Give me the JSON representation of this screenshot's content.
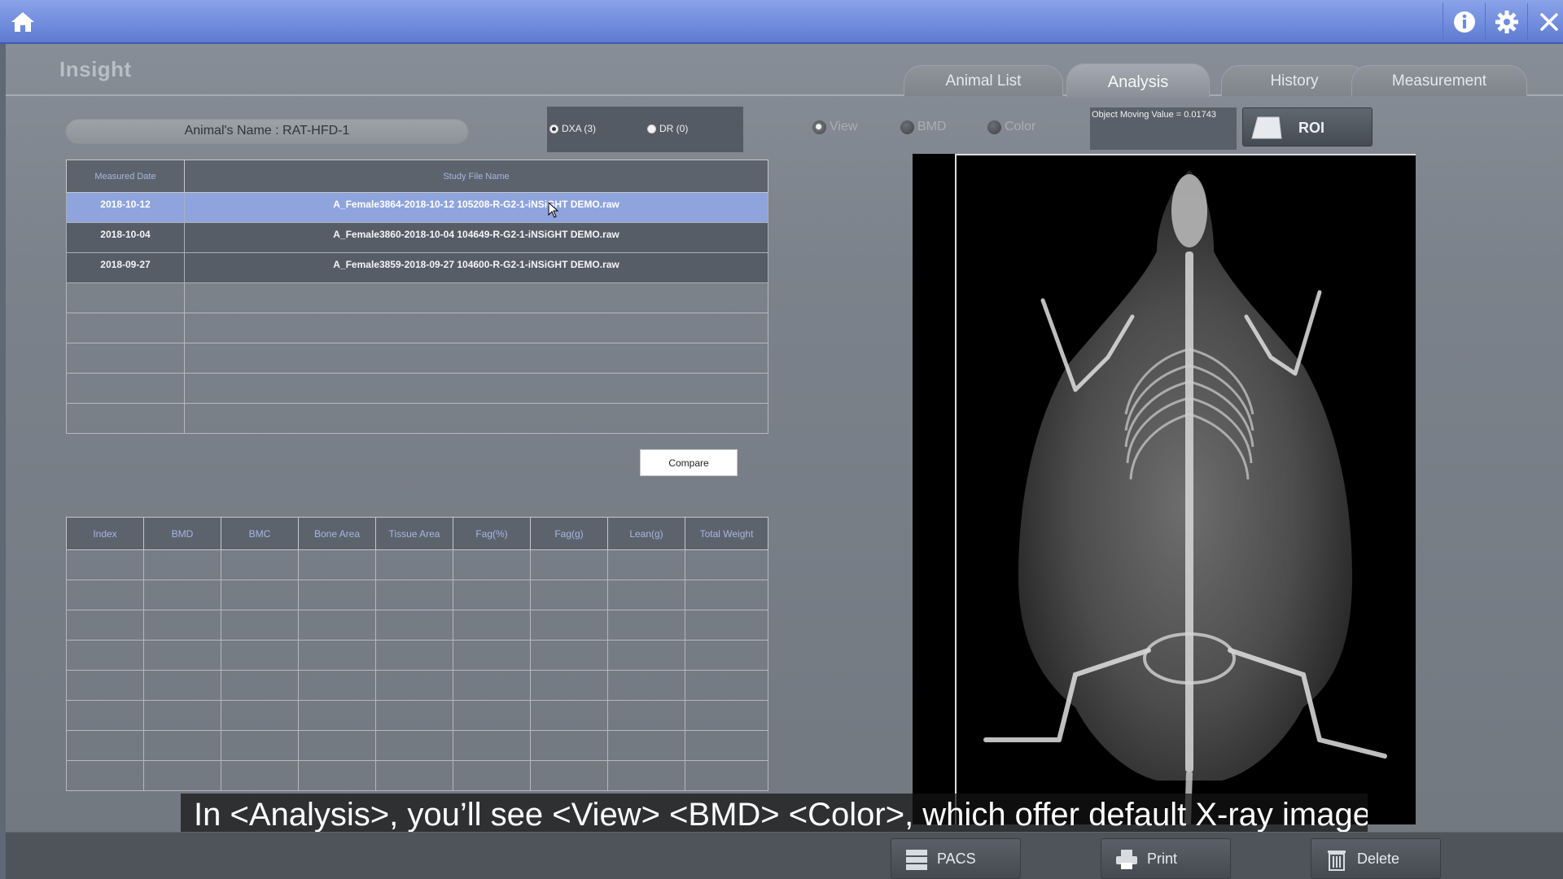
{
  "app": {
    "brand": "Insight"
  },
  "tabs": [
    {
      "label": "Animal List",
      "active": false
    },
    {
      "label": "Analysis",
      "active": true
    },
    {
      "label": "History",
      "active": false
    },
    {
      "label": "Measurement",
      "active": false
    }
  ],
  "animal": {
    "name_label": "Animal's Name  : RAT-HFD-1"
  },
  "modes": {
    "dxa": "DXA (3)",
    "dr": "DR (0)",
    "selected": "dxa"
  },
  "view_options": {
    "view": "View",
    "bmd": "BMD",
    "color": "Color",
    "selected": "view"
  },
  "object_moving": "Object Moving Value = 0.01743",
  "roi_label": "ROI",
  "study_table": {
    "headers": [
      "Measured Date",
      "Study File Name"
    ],
    "rows": [
      {
        "date": "2018-10-12",
        "file": "A_Female3864-2018-10-12 105208-R-G2-1-iNSiGHT DEMO.raw"
      },
      {
        "date": "2018-10-04",
        "file": "A_Female3860-2018-10-04 104649-R-G2-1-iNSiGHT DEMO.raw"
      },
      {
        "date": "2018-09-27",
        "file": "A_Female3859-2018-09-27 104600-R-G2-1-iNSiGHT DEMO.raw"
      }
    ],
    "selected_index": 0
  },
  "compare_label": "Compare",
  "result_table": {
    "headers": [
      "Index",
      "BMD",
      "BMC",
      "Bone Area",
      "Tissue Area",
      "Fag(%)",
      "Fag(g)",
      "Lean(g)",
      "Total Weight"
    ]
  },
  "subtitle": "In <Analysis>, you’ll see <View> <BMD> <Color>, which offer default X-ray image,",
  "bottom_buttons": {
    "pacs": "PACS",
    "print": "Print",
    "delete": "Delete"
  },
  "colors": {
    "topbar": "#6f8bdc",
    "selected_row": "#8fa4dd",
    "header_text": "#a5b6e4"
  }
}
